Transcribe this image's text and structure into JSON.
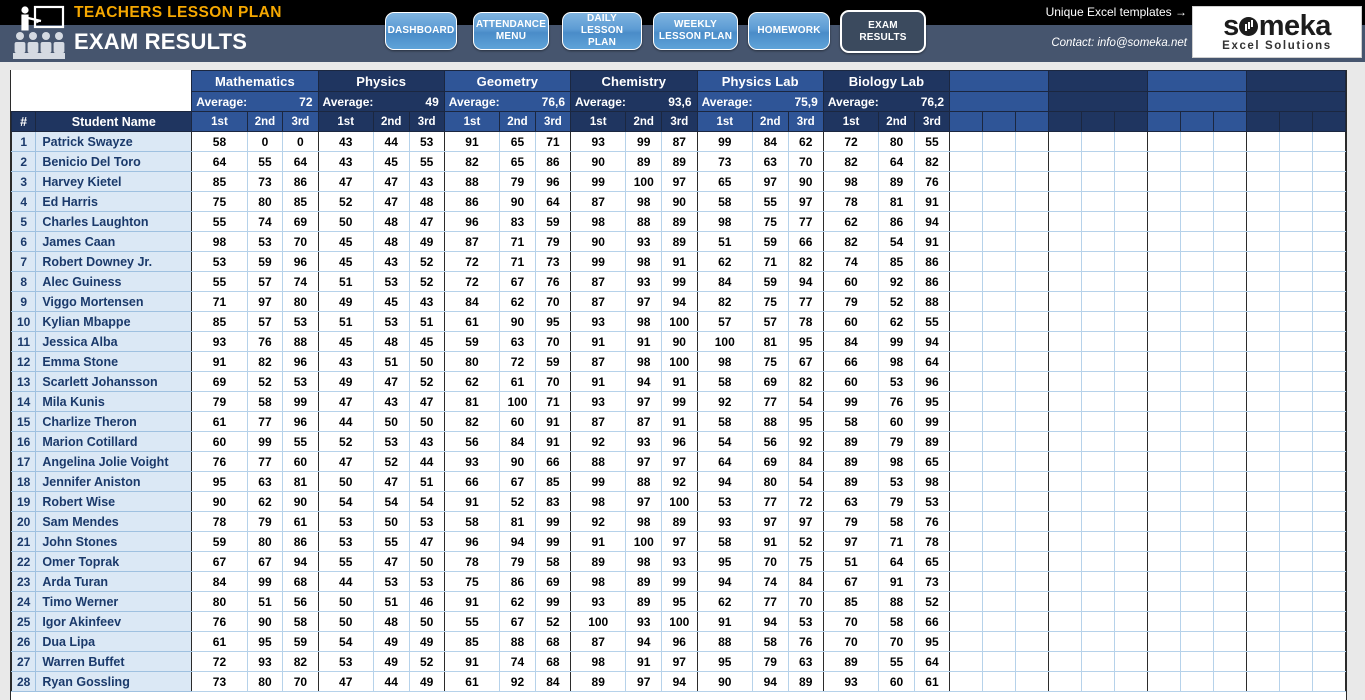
{
  "banner": {
    "title": "TEACHERS LESSON PLAN",
    "subtitle": "EXAM RESULTS",
    "promo": "Unique Excel templates →",
    "contact": "Contact: info@someka.net",
    "logo_word": "s",
    "logo_word_rest": "meka",
    "logo_tagline": "Excel Solutions",
    "colors": {
      "accent_gold": "#f6a800",
      "band_black": "#000000",
      "band_slate": "#46556e",
      "button_blue": "#5d9cd4",
      "active_dark": "#3b4a5e"
    }
  },
  "nav": {
    "buttons": [
      {
        "id": "dashboard",
        "label": "DASHBOARD",
        "active": false
      },
      {
        "id": "attendance",
        "label": "ATTENDANCE MENU",
        "active": false
      },
      {
        "id": "daily",
        "label": "DAILY LESSON PLAN",
        "active": false
      },
      {
        "id": "weekly",
        "label": "WEEKLY LESSON PLAN",
        "active": false
      },
      {
        "id": "homework",
        "label": "HOMEWORK",
        "active": false
      },
      {
        "id": "exam",
        "label": "EXAM RESULTS",
        "active": true
      }
    ]
  },
  "table": {
    "header": {
      "num_label": "#",
      "name_label": "Student Name",
      "average_label": "Average:",
      "exam_columns": [
        "1st",
        "2nd",
        "3rd"
      ]
    },
    "subjects": [
      {
        "name": "Mathematics",
        "average": "72",
        "empty": false
      },
      {
        "name": "Physics",
        "average": "49",
        "empty": false
      },
      {
        "name": "Geometry",
        "average": "76,6",
        "empty": false
      },
      {
        "name": "Chemistry",
        "average": "93,6",
        "empty": false
      },
      {
        "name": "Physics Lab",
        "average": "75,9",
        "empty": false
      },
      {
        "name": "Biology Lab",
        "average": "76,2",
        "empty": false
      },
      {
        "name": "",
        "average": "",
        "empty": true
      },
      {
        "name": "",
        "average": "",
        "empty": true
      },
      {
        "name": "",
        "average": "",
        "empty": true
      },
      {
        "name": "",
        "average": "",
        "empty": true
      }
    ],
    "rows": [
      {
        "num": "1",
        "name": "Patrick Swayze",
        "scores": [
          58,
          0,
          0,
          43,
          44,
          53,
          91,
          65,
          71,
          93,
          99,
          87,
          99,
          84,
          62,
          72,
          80,
          55
        ]
      },
      {
        "num": "2",
        "name": "Benicio Del Toro",
        "scores": [
          64,
          55,
          64,
          43,
          45,
          55,
          82,
          65,
          86,
          90,
          89,
          89,
          73,
          63,
          70,
          82,
          64,
          82
        ]
      },
      {
        "num": "3",
        "name": "Harvey Kietel",
        "scores": [
          85,
          73,
          86,
          47,
          47,
          43,
          88,
          79,
          96,
          99,
          100,
          97,
          65,
          97,
          90,
          98,
          89,
          76
        ]
      },
      {
        "num": "4",
        "name": "Ed Harris",
        "scores": [
          75,
          80,
          85,
          52,
          47,
          48,
          86,
          90,
          64,
          87,
          98,
          90,
          58,
          55,
          97,
          78,
          81,
          91
        ]
      },
      {
        "num": "5",
        "name": "Charles Laughton",
        "scores": [
          55,
          74,
          69,
          50,
          48,
          47,
          96,
          83,
          59,
          98,
          88,
          89,
          98,
          75,
          77,
          62,
          86,
          94
        ]
      },
      {
        "num": "6",
        "name": "James Caan",
        "scores": [
          98,
          53,
          70,
          45,
          48,
          49,
          87,
          71,
          79,
          90,
          93,
          89,
          51,
          59,
          66,
          82,
          54,
          91
        ]
      },
      {
        "num": "7",
        "name": "Robert Downey Jr.",
        "scores": [
          53,
          59,
          96,
          45,
          43,
          52,
          72,
          71,
          73,
          99,
          98,
          91,
          62,
          71,
          82,
          74,
          85,
          86
        ]
      },
      {
        "num": "8",
        "name": "Alec Guiness",
        "scores": [
          55,
          57,
          74,
          51,
          53,
          52,
          72,
          67,
          76,
          87,
          93,
          99,
          84,
          59,
          94,
          60,
          92,
          86
        ]
      },
      {
        "num": "9",
        "name": "Viggo Mortensen",
        "scores": [
          71,
          97,
          80,
          49,
          45,
          43,
          84,
          62,
          70,
          87,
          97,
          94,
          82,
          75,
          77,
          79,
          52,
          88
        ]
      },
      {
        "num": "10",
        "name": "Kylian Mbappe",
        "scores": [
          85,
          57,
          53,
          51,
          53,
          51,
          61,
          90,
          95,
          93,
          98,
          100,
          57,
          57,
          78,
          60,
          62,
          55
        ]
      },
      {
        "num": "11",
        "name": "Jessica Alba",
        "scores": [
          93,
          76,
          88,
          45,
          48,
          45,
          59,
          63,
          70,
          91,
          91,
          90,
          100,
          81,
          95,
          84,
          99,
          94
        ]
      },
      {
        "num": "12",
        "name": "Emma Stone",
        "scores": [
          91,
          82,
          96,
          43,
          51,
          50,
          80,
          72,
          59,
          87,
          98,
          100,
          98,
          75,
          67,
          66,
          98,
          64
        ]
      },
      {
        "num": "13",
        "name": "Scarlett Johansson",
        "scores": [
          69,
          52,
          53,
          49,
          47,
          52,
          62,
          61,
          70,
          91,
          94,
          91,
          58,
          69,
          82,
          60,
          53,
          96
        ]
      },
      {
        "num": "14",
        "name": "Mila Kunis",
        "scores": [
          79,
          58,
          99,
          47,
          43,
          47,
          81,
          100,
          71,
          93,
          97,
          99,
          92,
          77,
          54,
          99,
          76,
          95
        ]
      },
      {
        "num": "15",
        "name": "Charlize Theron",
        "scores": [
          61,
          77,
          96,
          44,
          50,
          50,
          82,
          60,
          91,
          87,
          87,
          91,
          58,
          88,
          95,
          58,
          60,
          99
        ]
      },
      {
        "num": "16",
        "name": "Marion Cotillard",
        "scores": [
          60,
          99,
          55,
          52,
          53,
          43,
          56,
          84,
          91,
          92,
          93,
          96,
          54,
          56,
          92,
          89,
          79,
          89
        ]
      },
      {
        "num": "17",
        "name": "Angelina Jolie Voight",
        "scores": [
          76,
          77,
          60,
          47,
          52,
          44,
          93,
          90,
          66,
          88,
          97,
          97,
          64,
          69,
          84,
          89,
          98,
          65
        ]
      },
      {
        "num": "18",
        "name": "Jennifer Aniston",
        "scores": [
          95,
          63,
          81,
          50,
          47,
          51,
          66,
          67,
          85,
          99,
          88,
          92,
          94,
          80,
          54,
          89,
          53,
          98
        ]
      },
      {
        "num": "19",
        "name": "Robert Wise",
        "scores": [
          90,
          62,
          90,
          54,
          54,
          54,
          91,
          52,
          83,
          98,
          97,
          100,
          53,
          77,
          72,
          63,
          79,
          53
        ]
      },
      {
        "num": "20",
        "name": "Sam Mendes",
        "scores": [
          78,
          79,
          61,
          53,
          50,
          53,
          58,
          81,
          99,
          92,
          98,
          89,
          93,
          97,
          97,
          79,
          58,
          76
        ]
      },
      {
        "num": "21",
        "name": "John Stones",
        "scores": [
          59,
          80,
          86,
          53,
          55,
          47,
          96,
          94,
          99,
          91,
          100,
          97,
          58,
          91,
          52,
          97,
          71,
          78
        ]
      },
      {
        "num": "22",
        "name": "Omer Toprak",
        "scores": [
          67,
          67,
          94,
          55,
          47,
          50,
          78,
          79,
          58,
          89,
          98,
          93,
          95,
          70,
          75,
          51,
          64,
          65
        ]
      },
      {
        "num": "23",
        "name": "Arda Turan",
        "scores": [
          84,
          99,
          68,
          44,
          53,
          53,
          75,
          86,
          69,
          98,
          89,
          99,
          94,
          74,
          84,
          67,
          91,
          73
        ]
      },
      {
        "num": "24",
        "name": "Timo Werner",
        "scores": [
          80,
          51,
          56,
          50,
          51,
          46,
          91,
          62,
          99,
          93,
          89,
          95,
          62,
          77,
          70,
          85,
          88,
          52
        ]
      },
      {
        "num": "25",
        "name": "Igor Akinfeev",
        "scores": [
          76,
          90,
          58,
          50,
          48,
          50,
          55,
          67,
          52,
          100,
          93,
          100,
          91,
          94,
          53,
          70,
          58,
          66
        ]
      },
      {
        "num": "26",
        "name": "Dua Lipa",
        "scores": [
          61,
          95,
          59,
          54,
          49,
          49,
          85,
          88,
          68,
          87,
          94,
          96,
          88,
          58,
          76,
          70,
          70,
          95
        ]
      },
      {
        "num": "27",
        "name": "Warren Buffet",
        "scores": [
          72,
          93,
          82,
          53,
          49,
          52,
          91,
          74,
          68,
          98,
          91,
          97,
          95,
          79,
          63,
          89,
          55,
          64
        ]
      },
      {
        "num": "28",
        "name": "Ryan Gossling",
        "scores": [
          73,
          80,
          70,
          47,
          44,
          49,
          61,
          92,
          84,
          89,
          97,
          94,
          90,
          94,
          89,
          93,
          60,
          61
        ]
      }
    ]
  }
}
